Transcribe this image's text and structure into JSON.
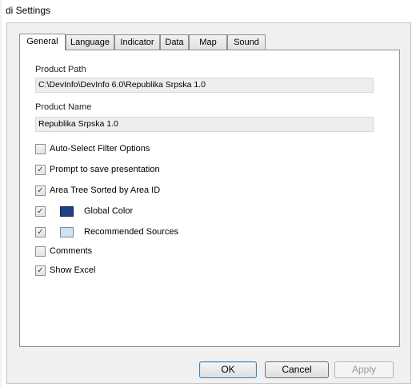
{
  "window": {
    "title": "di Settings"
  },
  "tabs": [
    {
      "label": "General",
      "active": true
    },
    {
      "label": "Language"
    },
    {
      "label": "Indicator"
    },
    {
      "label": "Data"
    },
    {
      "label": "Map"
    },
    {
      "label": "Sound"
    }
  ],
  "general": {
    "product_path": {
      "label": "Product Path",
      "value": "C:\\DevInfo\\DevInfo 6.0\\Republika Srpska 1.0"
    },
    "product_name": {
      "label": "Product Name",
      "value": "Republika Srpska 1.0"
    },
    "options": [
      {
        "label": "Auto-Select Filter Options",
        "checked": false
      },
      {
        "label": "Prompt to save presentation",
        "checked": true
      },
      {
        "label": "Area Tree Sorted by Area ID",
        "checked": true
      },
      {
        "label": "Global Color",
        "checked": true,
        "swatch_color": "#1f3f86"
      },
      {
        "label": "Recommended Sources",
        "checked": true,
        "swatch_color": "#cfe3f5"
      },
      {
        "label": "Comments",
        "checked": false
      },
      {
        "label": "Show Excel",
        "checked": true
      }
    ]
  },
  "buttons": {
    "ok": "OK",
    "cancel": "Cancel",
    "apply": "Apply"
  },
  "icons": {
    "checkmark": "✓"
  },
  "colors": {
    "accent": "#1f3f86",
    "dialog_bg": "#f0f0f0"
  }
}
